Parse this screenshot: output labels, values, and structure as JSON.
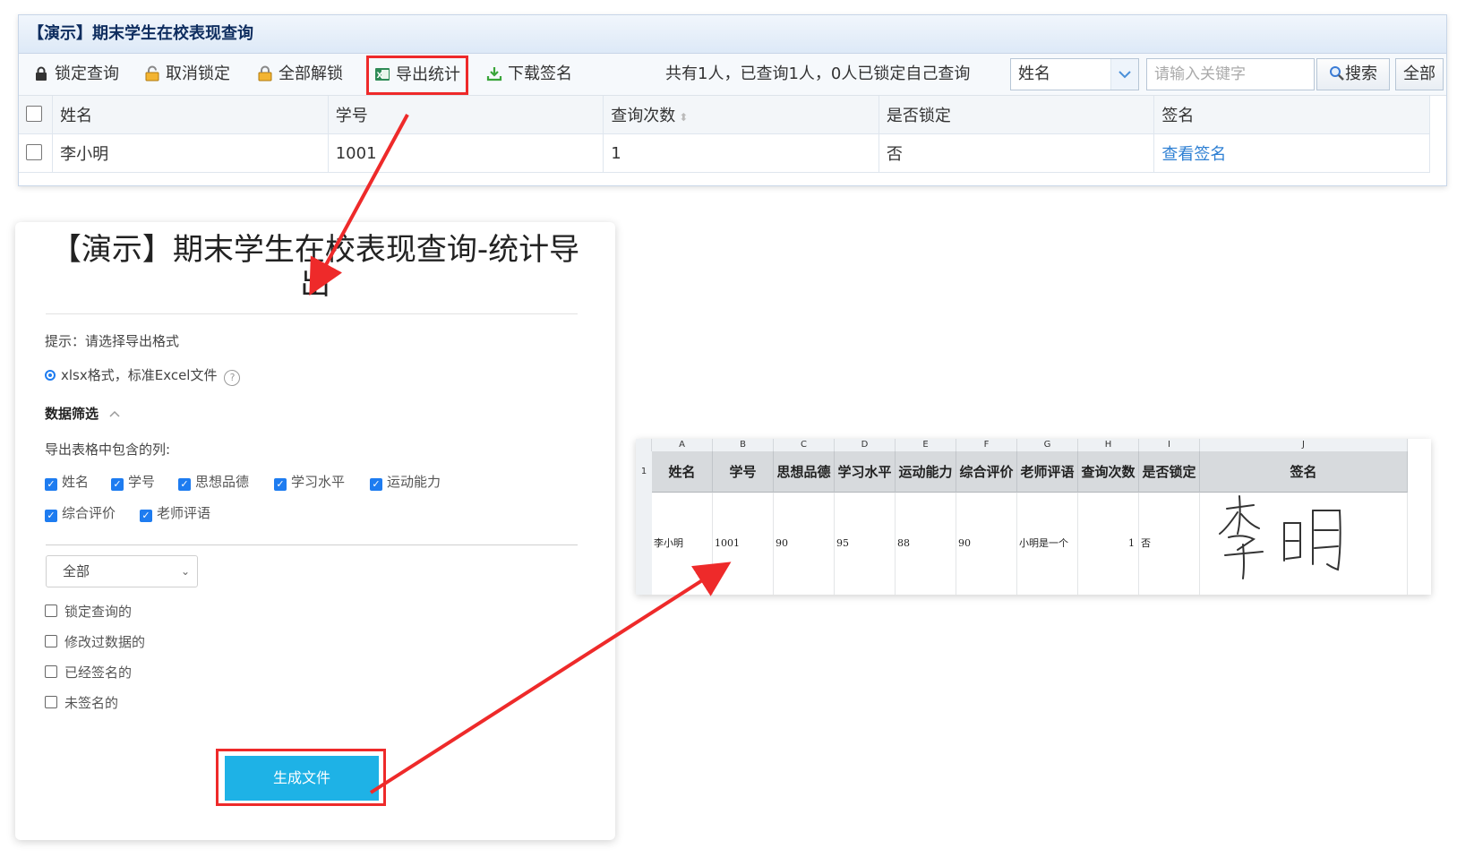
{
  "top": {
    "title": "【演示】期末学生在校表现查询",
    "toolbar": {
      "lock": "锁定查询",
      "unlock": "取消锁定",
      "unlock_all": "全部解锁",
      "export": "导出统计",
      "download_signature": "下载签名",
      "status": "共有1人，已查询1人，0人已锁定自己查询",
      "field_selected": "姓名",
      "keyword_placeholder": "请输入关键字",
      "search": "搜索",
      "all": "全部"
    },
    "columns": [
      "姓名",
      "学号",
      "查询次数",
      "是否锁定",
      "签名"
    ],
    "rows": [
      {
        "name": "李小明",
        "id": "1001",
        "count": "1",
        "locked": "否",
        "signature": "查看签名"
      }
    ]
  },
  "dialog": {
    "title": "【演示】期末学生在校表现查询-统计导出",
    "hint": "提示：请选择导出格式",
    "format": "xlsx格式，标准Excel文件",
    "help_icon": "?",
    "filter_heading": "数据筛选",
    "columns_label": "导出表格中包含的列:",
    "columns": [
      "姓名",
      "学号",
      "思想品德",
      "学习水平",
      "运动能力",
      "综合评价",
      "老师评语"
    ],
    "scope": "全部",
    "filters": [
      "锁定查询的",
      "修改过数据的",
      "已经签名的",
      "未签名的"
    ],
    "generate": "生成文件"
  },
  "sheet": {
    "col_letters": [
      "A",
      "B",
      "C",
      "D",
      "E",
      "F",
      "G",
      "H",
      "I",
      "J"
    ],
    "row_number": "1",
    "headers": [
      "姓名",
      "学号",
      "思想品德",
      "学习水平",
      "运动能力",
      "综合评价",
      "老师评语",
      "查询次数",
      "是否锁定",
      "签名"
    ],
    "row": [
      "李小明",
      "1001",
      "90",
      "95",
      "88",
      "90",
      "小明是一个",
      "1",
      "否",
      ""
    ],
    "signature_text": "李明"
  },
  "colors": {
    "highlight": "#ee2a2a",
    "button": "#1eb2e6",
    "checkbox": "#1e7cf0",
    "link": "#2d7fd3"
  }
}
